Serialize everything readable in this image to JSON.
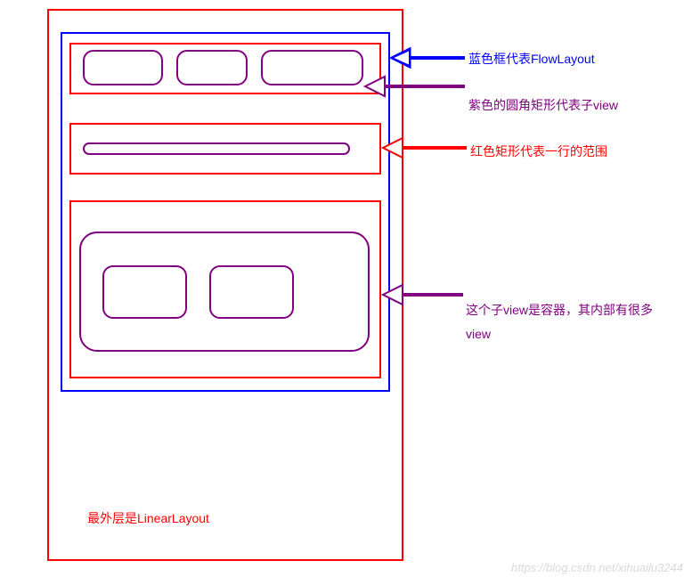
{
  "annotations": {
    "flowlayout": "蓝色框代表FlowLayout",
    "childview": "紫色的圆角矩形代表子view",
    "row": "红色矩形代表一行的范围",
    "container_child": "这个子view是容器，其内部有很多view",
    "outer": "最外层是LinearLayout"
  },
  "colors": {
    "outer_border": "#ff0000",
    "flowlayout_border": "#0000ff",
    "row_border": "#ff0000",
    "childview_border": "#800080"
  },
  "watermark": "https://blog.csdn.net/xihuailu3244",
  "structure": {
    "outer_layout": "LinearLayout",
    "flow_layout": {
      "rows": [
        {
          "children": 3,
          "shapes": "small-rounded-rects"
        },
        {
          "children": 1,
          "shapes": "long-flat-pill"
        },
        {
          "children": 1,
          "shapes": "container-with-2-inner-children"
        }
      ]
    }
  }
}
